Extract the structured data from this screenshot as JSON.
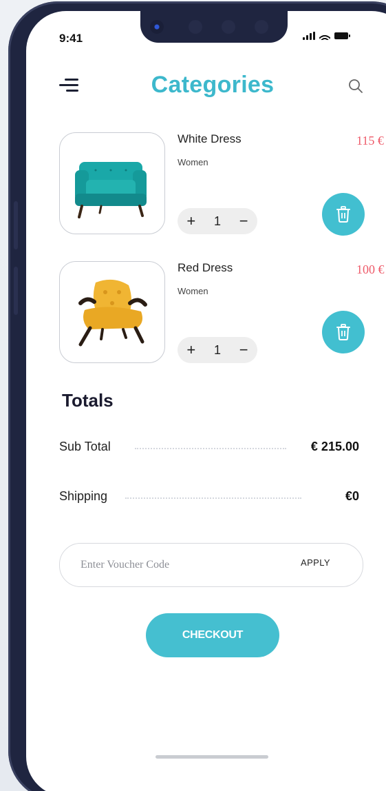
{
  "status_bar": {
    "time": "9:41"
  },
  "header": {
    "title": "Categories",
    "menu_icon": "menu-icon",
    "search_icon": "search-icon"
  },
  "cart": {
    "items": [
      {
        "name": "White Dress",
        "category": "Women",
        "price": "115 €",
        "quantity": "1",
        "increment_label": "+",
        "decrement_label": "−",
        "image_icon": "teal-armchair-image"
      },
      {
        "name": "Red Dress",
        "category": "Women",
        "price": "100 €",
        "quantity": "1",
        "increment_label": "+",
        "decrement_label": "−",
        "image_icon": "yellow-armchair-image"
      }
    ]
  },
  "totals": {
    "title": "Totals",
    "subtotal_label": "Sub Total",
    "subtotal_value": "€ 215.00",
    "shipping_label": "Shipping",
    "shipping_value": "€0"
  },
  "voucher": {
    "placeholder": "Enter Voucher Code",
    "apply_label": "APPLY"
  },
  "checkout": {
    "label": "CHECKOUT"
  },
  "colors": {
    "accent": "#3db8cc",
    "price": "#ee5b6a",
    "frame": "#1f2540"
  }
}
